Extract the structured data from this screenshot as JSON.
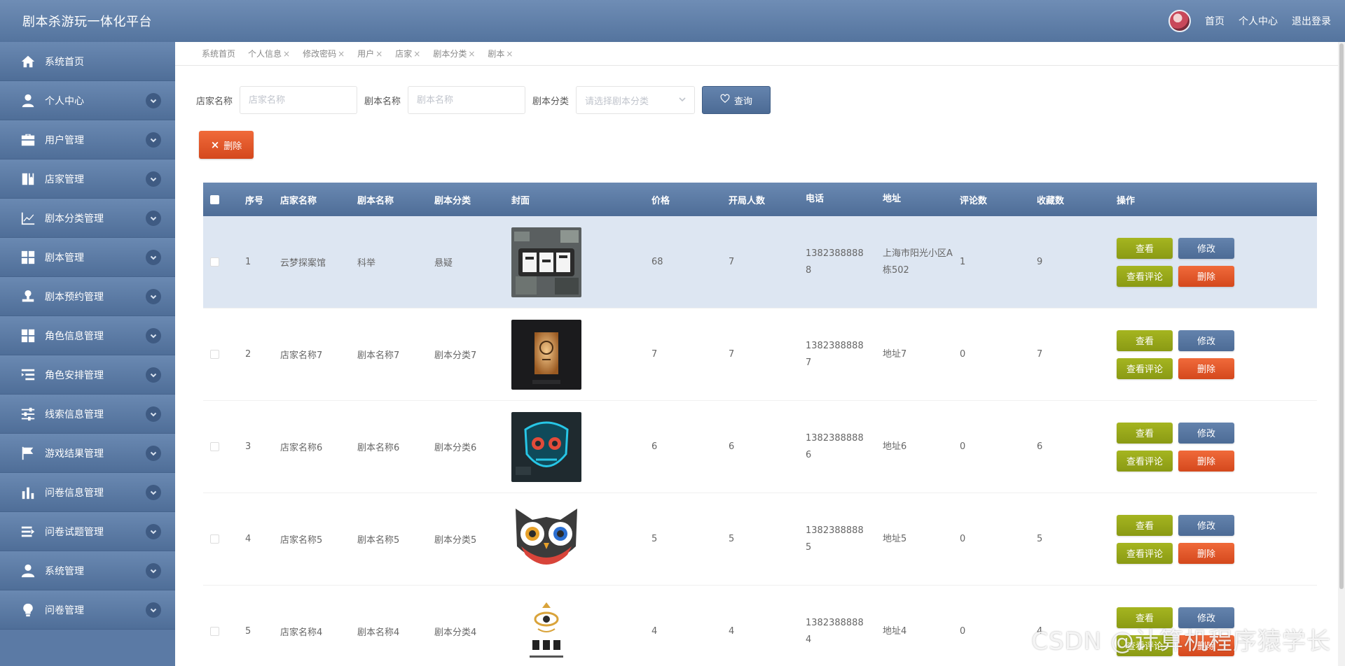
{
  "header": {
    "title": "剧本杀游玩一体化平台",
    "links": [
      "首页",
      "个人中心",
      "退出登录"
    ]
  },
  "sidebar": {
    "items": [
      {
        "label": "系统首页",
        "icon": "home-icon",
        "expandable": false
      },
      {
        "label": "个人中心",
        "icon": "user-icon",
        "expandable": true
      },
      {
        "label": "用户管理",
        "icon": "briefcase-icon",
        "expandable": true
      },
      {
        "label": "店家管理",
        "icon": "book-icon",
        "expandable": true
      },
      {
        "label": "剧本分类管理",
        "icon": "chart-icon",
        "expandable": true
      },
      {
        "label": "剧本管理",
        "icon": "grid-icon",
        "expandable": true
      },
      {
        "label": "剧本预约管理",
        "icon": "stamp-icon",
        "expandable": true
      },
      {
        "label": "角色信息管理",
        "icon": "grid-icon",
        "expandable": true
      },
      {
        "label": "角色安排管理",
        "icon": "list-indent-icon",
        "expandable": true
      },
      {
        "label": "线索信息管理",
        "icon": "sliders-icon",
        "expandable": true
      },
      {
        "label": "游戏结果管理",
        "icon": "flag-icon",
        "expandable": true
      },
      {
        "label": "问卷信息管理",
        "icon": "bar-chart-icon",
        "expandable": true
      },
      {
        "label": "问卷试题管理",
        "icon": "list-arrow-icon",
        "expandable": true
      },
      {
        "label": "系统管理",
        "icon": "person-icon",
        "expandable": true
      },
      {
        "label": "问卷管理",
        "icon": "bulb-icon",
        "expandable": true
      }
    ]
  },
  "tabs": [
    {
      "label": "系统首页",
      "closable": false
    },
    {
      "label": "个人信息",
      "closable": true
    },
    {
      "label": "修改密码",
      "closable": true
    },
    {
      "label": "用户",
      "closable": true
    },
    {
      "label": "店家",
      "closable": true
    },
    {
      "label": "剧本分类",
      "closable": true
    },
    {
      "label": "剧本",
      "closable": true
    }
  ],
  "tab_close": "×",
  "search": {
    "store_label": "店家名称",
    "store_placeholder": "店家名称",
    "script_label": "剧本名称",
    "script_placeholder": "剧本名称",
    "category_label": "剧本分类",
    "category_placeholder": "请选择剧本分类",
    "query_button": "查询"
  },
  "toolbar": {
    "delete_label": "删除",
    "delete_icon": "×"
  },
  "table": {
    "headers": {
      "index": "序号",
      "store": "店家名称",
      "script": "剧本名称",
      "category": "剧本分类",
      "cover": "封面",
      "price": "价格",
      "players": "开局人数",
      "phone": "电话",
      "address": "地址",
      "reviews": "评论数",
      "favorites": "收藏数",
      "ops": "操作"
    },
    "rows": [
      {
        "index": "1",
        "store": "云梦探案馆",
        "script": "科举",
        "category": "悬疑",
        "cover": "juben-sha-title-cover",
        "price": "68",
        "players": "7",
        "phone": "13823888888",
        "address": "上海市阳光小区A栋502",
        "reviews": "1",
        "favorites": "9"
      },
      {
        "index": "2",
        "store": "店家名称7",
        "script": "剧本名称7",
        "category": "剧本分类7",
        "cover": "lantern-sign-cover",
        "price": "7",
        "players": "7",
        "phone": "13823888887",
        "address": "地址7",
        "reviews": "0",
        "favorites": "7"
      },
      {
        "index": "3",
        "store": "店家名称6",
        "script": "剧本名称6",
        "category": "剧本分类6",
        "cover": "neon-mask-cover",
        "price": "6",
        "players": "6",
        "phone": "13823888886",
        "address": "地址6",
        "reviews": "0",
        "favorites": "6"
      },
      {
        "index": "4",
        "store": "店家名称5",
        "script": "剧本名称5",
        "category": "剧本分类5",
        "cover": "owl-face-cover",
        "price": "5",
        "players": "5",
        "phone": "13823888885",
        "address": "地址5",
        "reviews": "0",
        "favorites": "5"
      },
      {
        "index": "5",
        "store": "店家名称4",
        "script": "剧本名称4",
        "category": "剧本分类4",
        "cover": "eye-logo-cover",
        "price": "4",
        "players": "4",
        "phone": "13823888884",
        "address": "地址4",
        "reviews": "0",
        "favorites": "4"
      }
    ],
    "ops": {
      "view": "查看",
      "edit": "修改",
      "view_reviews": "查看评论",
      "delete": "删除"
    }
  },
  "watermark": "CSDN @计算机程序猿学长",
  "colors": {
    "header": "#5f7fa9",
    "sidebar": "#5b7aa5",
    "olive_button": "#9aab1a",
    "blue_button": "#587aa3",
    "red_button": "#e45a2b",
    "row_highlight": "#dde6f2"
  }
}
